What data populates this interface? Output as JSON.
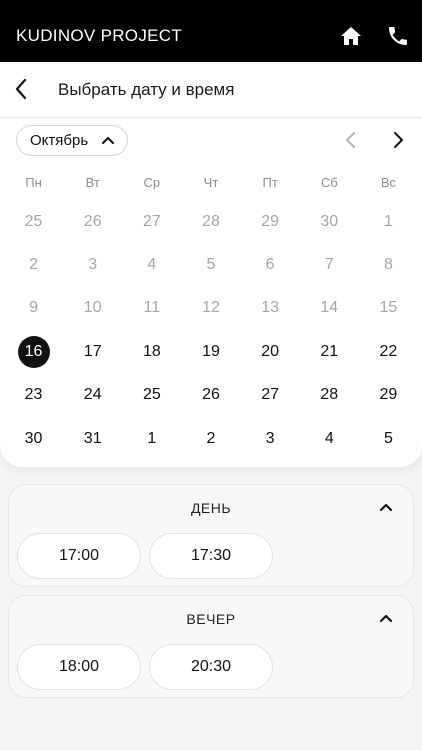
{
  "app": {
    "brand": "KUDINOV PROJECT",
    "icons": [
      "home-icon",
      "phone-icon"
    ]
  },
  "header": {
    "title": "Выбрать дату и время",
    "back_icon": "chevron-left-icon"
  },
  "calendar": {
    "month": "Октябрь",
    "weekdays": [
      "Пн",
      "Вт",
      "Ср",
      "Чт",
      "Пт",
      "Сб",
      "Вс"
    ],
    "selected_day": "16",
    "days": [
      {
        "label": "25",
        "state": "muted"
      },
      {
        "label": "26",
        "state": "muted"
      },
      {
        "label": "27",
        "state": "muted"
      },
      {
        "label": "28",
        "state": "muted"
      },
      {
        "label": "29",
        "state": "muted"
      },
      {
        "label": "30",
        "state": "muted"
      },
      {
        "label": "1",
        "state": "muted"
      },
      {
        "label": "2",
        "state": "muted"
      },
      {
        "label": "3",
        "state": "muted"
      },
      {
        "label": "4",
        "state": "muted"
      },
      {
        "label": "5",
        "state": "muted"
      },
      {
        "label": "6",
        "state": "muted"
      },
      {
        "label": "7",
        "state": "muted"
      },
      {
        "label": "8",
        "state": "muted"
      },
      {
        "label": "9",
        "state": "muted"
      },
      {
        "label": "10",
        "state": "muted"
      },
      {
        "label": "11",
        "state": "muted"
      },
      {
        "label": "12",
        "state": "muted"
      },
      {
        "label": "13",
        "state": "muted"
      },
      {
        "label": "14",
        "state": "muted"
      },
      {
        "label": "15",
        "state": "muted"
      },
      {
        "label": "16",
        "state": "selected"
      },
      {
        "label": "17",
        "state": "active"
      },
      {
        "label": "18",
        "state": "active"
      },
      {
        "label": "19",
        "state": "active"
      },
      {
        "label": "20",
        "state": "active"
      },
      {
        "label": "21",
        "state": "active"
      },
      {
        "label": "22",
        "state": "active"
      },
      {
        "label": "23",
        "state": "active"
      },
      {
        "label": "24",
        "state": "active"
      },
      {
        "label": "25",
        "state": "active"
      },
      {
        "label": "26",
        "state": "active"
      },
      {
        "label": "27",
        "state": "active"
      },
      {
        "label": "28",
        "state": "active"
      },
      {
        "label": "29",
        "state": "active"
      },
      {
        "label": "30",
        "state": "active"
      },
      {
        "label": "31",
        "state": "active"
      },
      {
        "label": "1",
        "state": "active"
      },
      {
        "label": "2",
        "state": "active"
      },
      {
        "label": "3",
        "state": "active"
      },
      {
        "label": "4",
        "state": "active"
      },
      {
        "label": "5",
        "state": "active"
      }
    ]
  },
  "sections": [
    {
      "title": "ДЕНЬ",
      "slots": [
        "17:00",
        "17:30"
      ]
    },
    {
      "title": "ВЕЧЕР",
      "slots": [
        "18:00",
        "20:30"
      ]
    }
  ],
  "colors": {
    "accent": "#111111",
    "muted_text": "#a6a6a6",
    "topbar": "#000000"
  }
}
